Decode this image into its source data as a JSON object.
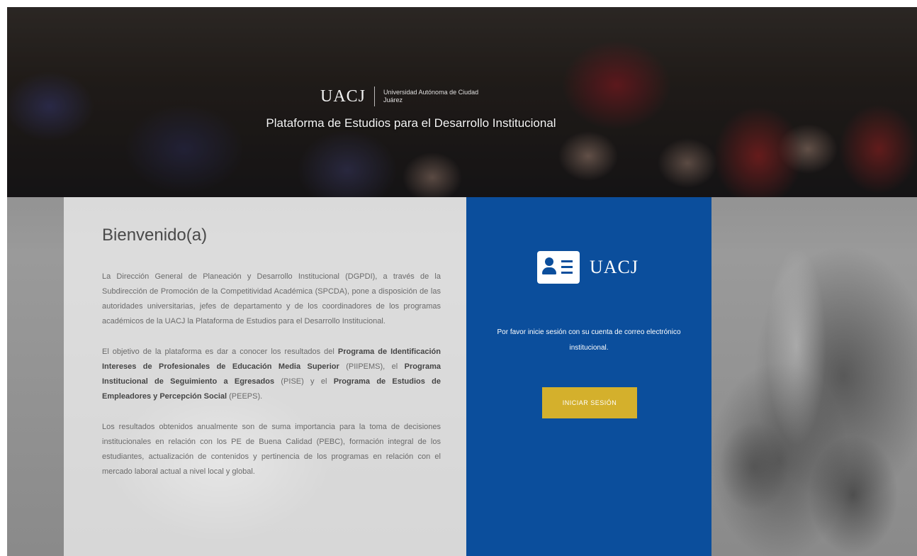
{
  "hero": {
    "logo_text": "UACJ",
    "logo_subtitle": "Universidad Autónoma de Ciudad Juárez",
    "title": "Plataforma de Estudios para el Desarrollo Institucional"
  },
  "welcome": {
    "heading": "Bienvenido(a)",
    "p1": "La Dirección General de Planeación y Desarrollo Institucional (DGPDI), a través de la Subdirección de Promoción de la Competitividad Académica (SPCDA), pone a disposición de las autoridades universitarias, jefes de departamento y de los coordinadores de los programas académicos de la UACJ la Plataforma de Estudios para el Desarrollo Institucional.",
    "p2_intro": "El objetivo de la plataforma es dar a conocer los resultados del ",
    "p2_prog1": "Programa de Identificación Intereses de Profesionales de Educación Media Superior",
    "p2_mid1": " (PIIPEMS), el ",
    "p2_prog2": "Programa Institucional de Seguimiento a Egresados",
    "p2_mid2": " (PISE) y el ",
    "p2_prog3": "Programa de Estudios de Empleadores y Percepción Social",
    "p2_end": " (PEEPS).",
    "p3": "Los resultados obtenidos anualmente son de suma importancia para la toma de decisiones institucionales en relación con los PE de Buena Calidad (PEBC), formación integral de los estudiantes, actualización de contenidos y pertinencia de los programas en relación con el mercado laboral actual a nivel local y global."
  },
  "login": {
    "brand": "UACJ",
    "message": "Por favor inicie sesión con su cuenta de correo electrónico institucional.",
    "button_label": "INICIAR SESIÓN"
  },
  "colors": {
    "login_blue": "#0b4e9c",
    "button_gold": "#d4b02c"
  }
}
